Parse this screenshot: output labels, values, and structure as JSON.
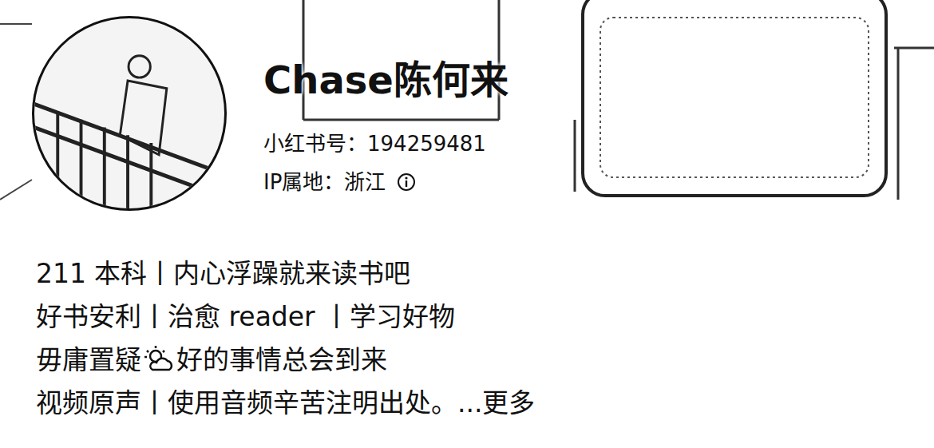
{
  "profile": {
    "name": "Chase陈何来",
    "id": "小红书号：194259481",
    "ip": "IP属地：浙江"
  },
  "bio": {
    "lines": [
      {
        "kind": "plain",
        "text": "211 本科丨内心浮躁就来读书吧"
      },
      {
        "kind": "plain",
        "text": "好书安利丨治愈 reader 丨学习好物"
      },
      {
        "kind": "icon",
        "text": "毋庸置疑",
        "after": "好的事情总会到来"
      },
      {
        "kind": "more",
        "text": "视频原声丨使用音频辛苦注明出处。",
        "more": "...更多"
      }
    ]
  }
}
